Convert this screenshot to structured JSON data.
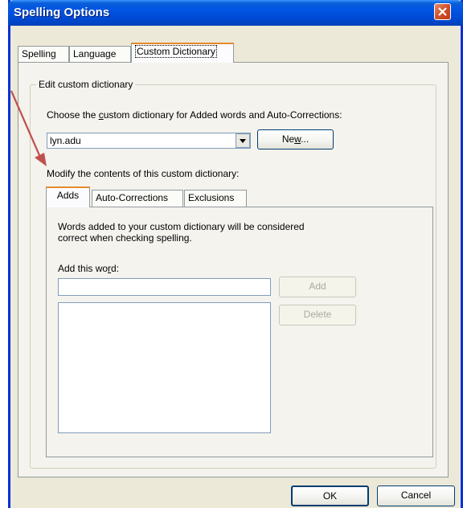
{
  "window": {
    "title": "Spelling Options"
  },
  "tabs": [
    {
      "label": "Spelling"
    },
    {
      "label": "Language"
    },
    {
      "label": "Custom Dictionary"
    }
  ],
  "group": {
    "title": "Edit custom dictionary",
    "choose_pre": "Choose the ",
    "choose_accel": "c",
    "choose_post": "ustom dictionary for Added words and Auto-Corrections:",
    "dictionary_value": "lyn.adu",
    "new_pre": "Ne",
    "new_accel": "w",
    "new_post": "...",
    "modify_label": "Modify the contents of this custom dictionary:"
  },
  "inner_tabs": [
    {
      "label": "Adds"
    },
    {
      "label": "Auto-Corrections"
    },
    {
      "label": "Exclusions"
    }
  ],
  "adds": {
    "description_line1": "Words added to your custom dictionary will be considered",
    "description_line2": "correct when checking spelling.",
    "add_label_pre": "Add this wo",
    "add_label_accel": "r",
    "add_label_post": "d:",
    "word_value": "",
    "add_button": "Add",
    "delete_button": "Delete"
  },
  "footer": {
    "ok_label": "OK",
    "cancel_label": "Cancel"
  },
  "colors": {
    "titlebar": "#0054e3",
    "dialog_bg": "#ece9d8",
    "annotation_arrow": "#c0504d"
  }
}
